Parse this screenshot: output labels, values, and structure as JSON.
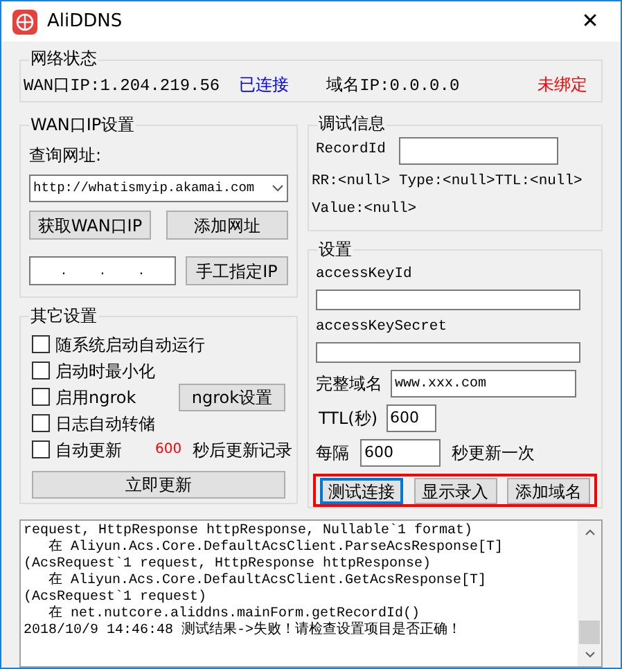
{
  "window": {
    "title": "AliDDNS",
    "close": "✕"
  },
  "network_status": {
    "title": "网络状态",
    "wan_label": "WAN口IP:",
    "wan_ip": "1.204.219.56",
    "wan_status": "已连接",
    "domain_ip_label": "域名IP:",
    "domain_ip": "0.0.0.0",
    "domain_status": "未绑定"
  },
  "wan_settings": {
    "title": "WAN口IP设置",
    "query_label": "查询网址:",
    "query_url": "http://whatismyip.akamai.com",
    "get_button": "获取WAN口IP",
    "add_button": "添加网址",
    "ip_dots": [
      ".",
      ".",
      "."
    ],
    "manual_button": "手工指定IP"
  },
  "other_settings": {
    "title": "其它设置",
    "options": [
      {
        "kind": "plain",
        "label": "随系统启动自动运行",
        "checked": false
      },
      {
        "kind": "plain",
        "label": "启动时最小化",
        "checked": false
      },
      {
        "kind": "with_button",
        "label": "启用ngrok",
        "checked": false,
        "button": "ngrok设置"
      },
      {
        "kind": "plain",
        "label": "日志自动转储",
        "checked": false
      },
      {
        "kind": "with_countdown",
        "label": "自动更新",
        "checked": false,
        "countdown": "600",
        "suffix": "秒后更新记录"
      }
    ],
    "update_now": "立即更新"
  },
  "debug": {
    "title": "调试信息",
    "record_id_label": "RecordId",
    "rr_line": "RR:<null> Type:<null>TTL:<null>",
    "value_line": "Value:<null>"
  },
  "settings": {
    "title": "设置",
    "access_key_id_label": "accessKeyId",
    "access_key_secret_label": "accessKeySecret",
    "domain_label": "完整域名",
    "domain_value": "www.xxx.com",
    "ttl_label": "TTL(秒)",
    "ttl_value": "600",
    "interval_label": "每隔",
    "interval_value": "600",
    "interval_suffix": "秒更新一次",
    "buttons_highlighted": true,
    "buttons": [
      {
        "label": "测试连接",
        "focused": true
      },
      {
        "label": "显示录入",
        "focused": false
      },
      {
        "label": "添加域名",
        "focused": false
      }
    ]
  },
  "log": {
    "lines": [
      "request, HttpResponse httpResponse, Nullable`1 format)",
      "   在 Aliyun.Acs.Core.DefaultAcsClient.ParseAcsResponse[T]",
      "(AcsRequest`1 request, HttpResponse httpResponse)",
      "   在 Aliyun.Acs.Core.DefaultAcsClient.GetAcsResponse[T]",
      "(AcsRequest`1 request)",
      "   在 net.nutcore.aliddns.mainForm.getRecordId()",
      "2018/10/9 14:46:48 测试结果->失败！请检查设置项目是否正确！"
    ]
  }
}
